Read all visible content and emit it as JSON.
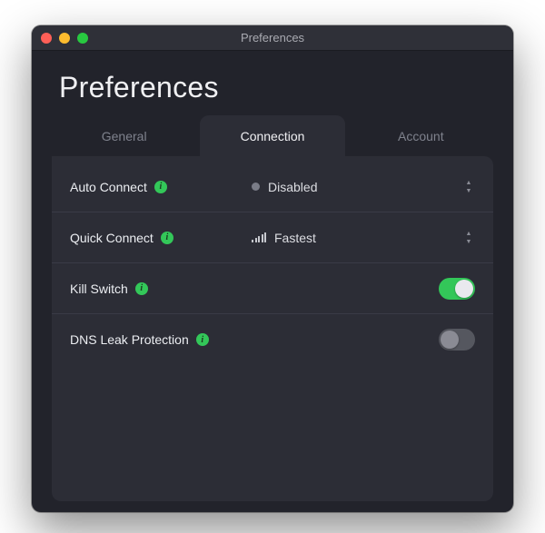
{
  "window": {
    "title": "Preferences"
  },
  "header": {
    "title": "Preferences"
  },
  "tabs": {
    "items": [
      {
        "label": "General",
        "active": false
      },
      {
        "label": "Connection",
        "active": true
      },
      {
        "label": "Account",
        "active": false
      }
    ]
  },
  "rows": {
    "auto_connect": {
      "label": "Auto Connect",
      "value": "Disabled"
    },
    "quick_connect": {
      "label": "Quick Connect",
      "value": "Fastest"
    },
    "kill_switch": {
      "label": "Kill Switch",
      "enabled": true
    },
    "dns_leak": {
      "label": "DNS Leak Protection",
      "enabled": false
    }
  },
  "colors": {
    "accent_green": "#33c759",
    "bg_window": "#22232b",
    "bg_panel": "#2c2d36"
  }
}
